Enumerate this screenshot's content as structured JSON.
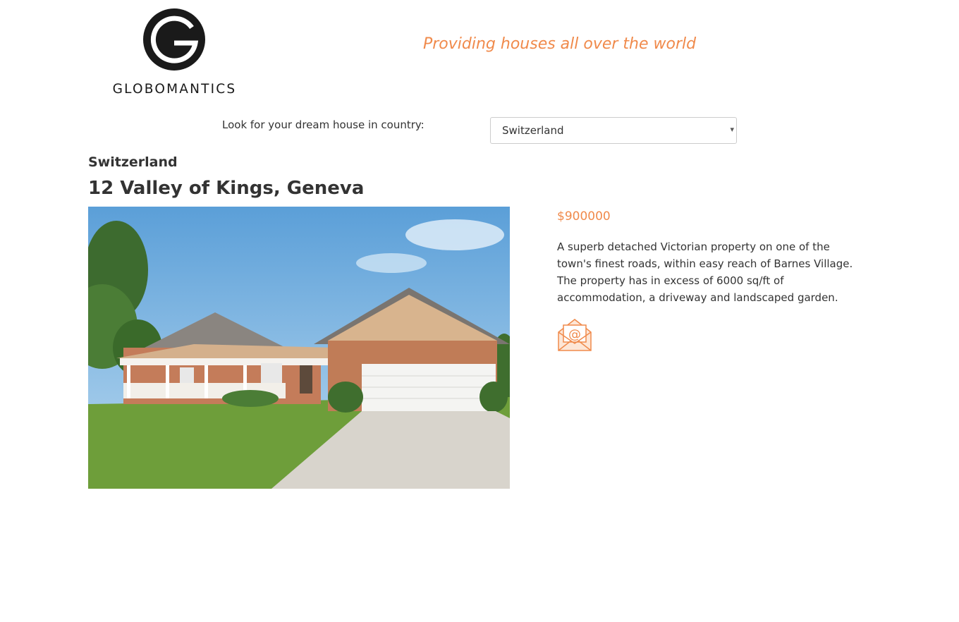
{
  "header": {
    "logo_text": "GLOBOMANTICS",
    "tagline": "Providing houses all over the world"
  },
  "search": {
    "label": "Look for your dream house in country:",
    "selected_country": "Switzerland",
    "caret_icon": "▾"
  },
  "listing": {
    "country": "Switzerland",
    "address": "12 Valley of Kings, Geneva",
    "price": "$900000",
    "description": "A superb detached Victorian property on one of the town's finest roads, within easy reach of Barnes Village. The property has in excess of 6000 sq/ft of accommodation, a driveway and landscaped garden.",
    "contact_icon": "email-envelope-icon"
  },
  "colors": {
    "accent": "#f08a4b",
    "text": "#333333",
    "logo": "#1a1a1a"
  }
}
